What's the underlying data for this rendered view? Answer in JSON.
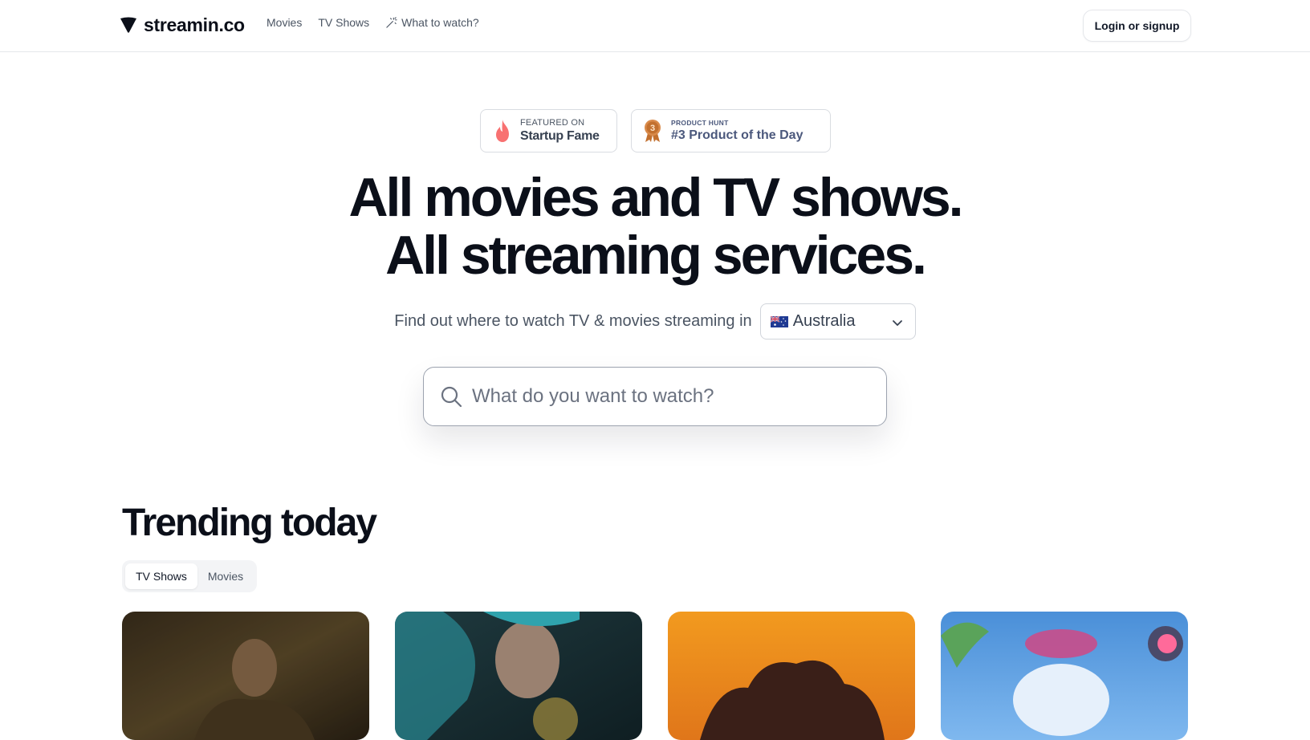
{
  "header": {
    "logo_text": "streamin.co",
    "nav": [
      {
        "label": "Movies"
      },
      {
        "label": "TV Shows"
      },
      {
        "label": "What to watch?",
        "icon": "magic-wand-icon"
      }
    ],
    "login_label": "Login or signup"
  },
  "badges": {
    "startup_fame": {
      "small": "FEATURED ON",
      "big": "Startup Fame",
      "icon": "flame-icon"
    },
    "product_hunt": {
      "small": "PRODUCT HUNT",
      "big": "#3 Product of the Day",
      "icon": "medal-icon",
      "medal_number": "3"
    }
  },
  "hero": {
    "line1": "All movies and TV shows.",
    "line2": "All streaming services.",
    "subtitle": "Find out where to watch TV & movies streaming in",
    "country": "Australia",
    "country_flag": "australia-flag-icon"
  },
  "search": {
    "placeholder": "What do you want to watch?",
    "value": ""
  },
  "trending": {
    "title": "Trending today",
    "tabs": [
      {
        "label": "TV Shows",
        "active": true
      },
      {
        "label": "Movies",
        "active": false
      }
    ],
    "cards_count": 4
  },
  "colors": {
    "text_primary": "#0b0f19",
    "text_muted": "#4b5563",
    "border": "#e5e7eb",
    "flame": "#f87171",
    "medal": "#c2702f"
  }
}
